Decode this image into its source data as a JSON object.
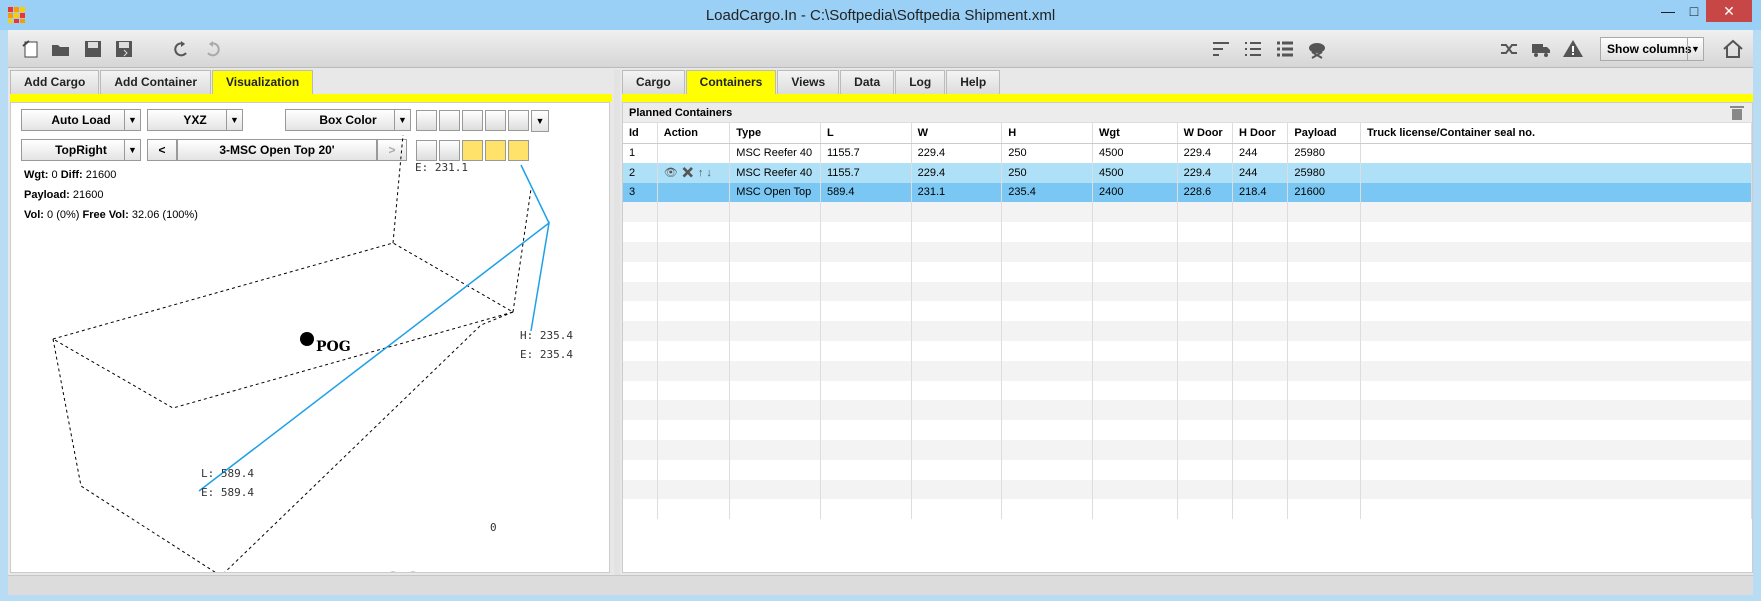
{
  "window": {
    "title": "LoadCargo.In - C:\\Softpedia\\Softpedia Shipment.xml",
    "minimize": "—",
    "maximize": "□",
    "close": "✕"
  },
  "toolbar": {
    "show_columns": "Show columns"
  },
  "left_tabs": [
    "Add Cargo",
    "Add Container",
    "Visualization"
  ],
  "left_active": 2,
  "viz": {
    "auto_load": "Auto Load",
    "orientation": "YXZ",
    "box_color": "Box Color",
    "view": "TopRight",
    "prev": "<",
    "container": "3-MSC Open Top 20'",
    "next": ">",
    "wgt_label": "Wgt:",
    "wgt": "0",
    "diff_label": "Diff:",
    "diff": "21600",
    "payload_label": "Payload:",
    "payload": "21600",
    "vol_label": "Vol:",
    "vol": "0 (0%)",
    "freevol_label": "Free Vol:",
    "freevol": "32.06 (100%)",
    "pog": "POG",
    "w_label": "E: 231.1",
    "h_label1": "H: 235.4",
    "h_label2": "E: 235.4",
    "l_label1": "L: 589.4",
    "l_label2": "E: 589.4",
    "slider_value": "0"
  },
  "right_tabs": [
    "Cargo",
    "Containers",
    "Views",
    "Data",
    "Log",
    "Help"
  ],
  "right_active": 1,
  "planned_title": "Planned Containers",
  "table": {
    "columns": [
      "Id",
      "Action",
      "Type",
      "L",
      "W",
      "H",
      "Wgt",
      "W Door",
      "H Door",
      "Payload",
      "Truck license/Container seal no."
    ],
    "rows": [
      [
        "1",
        "",
        "MSC Reefer 40",
        "1155.7",
        "229.4",
        "250",
        "4500",
        "229.4",
        "244",
        "25980",
        ""
      ],
      [
        "2",
        "",
        "MSC Reefer 40",
        "1155.7",
        "229.4",
        "250",
        "4500",
        "229.4",
        "244",
        "25980",
        ""
      ],
      [
        "3",
        "",
        "MSC Open Top",
        "589.4",
        "231.1",
        "235.4",
        "2400",
        "228.6",
        "218.4",
        "21600",
        ""
      ]
    ]
  }
}
